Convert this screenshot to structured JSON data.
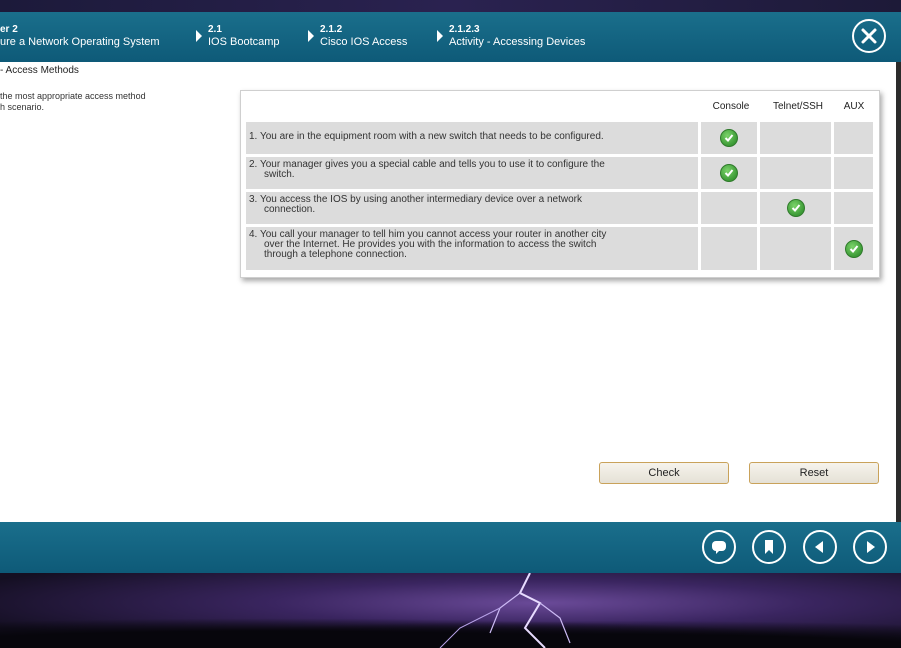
{
  "header": {
    "breadcrumbs": [
      {
        "num": "er 2",
        "text": "ure a Network Operating System"
      },
      {
        "num": "2.1",
        "text": "IOS Bootcamp"
      },
      {
        "num": "2.1.2",
        "text": "Cisco IOS Access"
      },
      {
        "num": "2.1.2.3",
        "text": "Activity - Accessing Devices"
      }
    ],
    "close_icon": "close-icon"
  },
  "content": {
    "section_title": "- Access Methods",
    "instructions_line1": "the most appropriate access method",
    "instructions_line2": "h scenario.",
    "columns": [
      "Console",
      "Telnet/SSH",
      "AUX"
    ],
    "rows": [
      {
        "line1": "1. You are in the equipment room with a new switch that needs to be configured.",
        "line2": "",
        "line3": "",
        "answer": "Console"
      },
      {
        "line1": "2. Your manager gives you a special cable and tells you to use it to configure the",
        "line2": "switch.",
        "line3": "",
        "answer": "Console"
      },
      {
        "line1": "3. You access the IOS by using another intermediary device over a network",
        "line2": "connection.",
        "line3": "",
        "answer": "Telnet/SSH"
      },
      {
        "line1": "4. You call your manager to tell him you cannot access your router in another city",
        "line2": "over the Internet. He provides you with the information to access the switch",
        "line3": "through a telephone connection.",
        "answer": "AUX"
      }
    ],
    "check_label": "Check",
    "reset_label": "Reset"
  },
  "footer": {
    "icons": [
      "comment-icon",
      "bookmark-icon",
      "previous-icon",
      "next-icon"
    ]
  },
  "colors": {
    "header_bg": "#0e5a78",
    "row_bg": "#dcdcdc",
    "check_green": "#3c9a36",
    "button_border": "#c9a25a"
  }
}
